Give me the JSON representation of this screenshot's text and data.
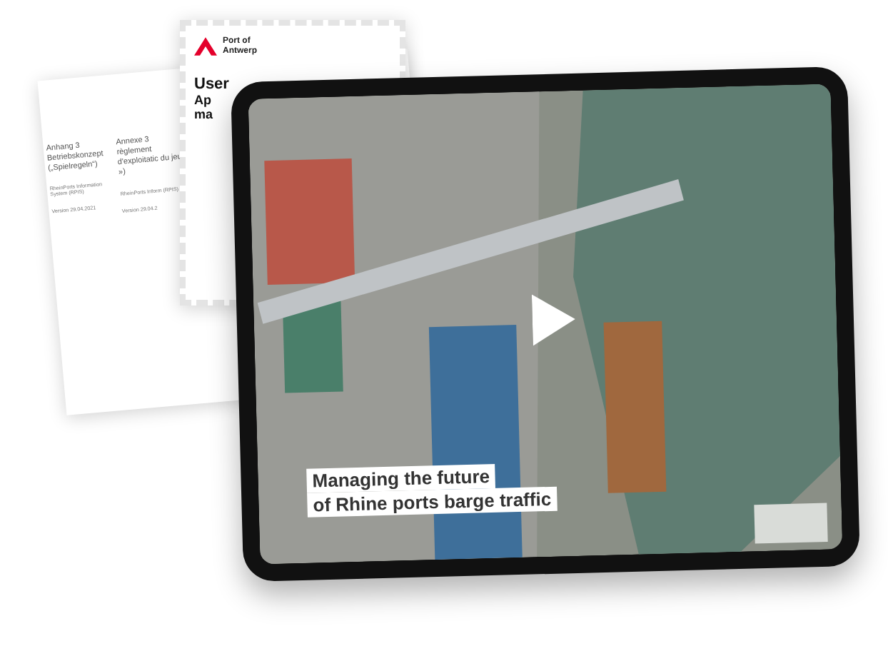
{
  "documents": [
    {
      "kind": "annex",
      "columns": [
        {
          "heading": "Anhang 3 Betriebskonzept („Spielregeln“)",
          "note": "RheinPorts Information System (RPIS)",
          "version": "Version 29.04.2021"
        },
        {
          "heading": "Annexe 3 règlement d'exploitatic du jeu »)",
          "note": "RheinPorts Inform (RPIS)",
          "version": "Version 29.04.2"
        }
      ]
    },
    {
      "kind": "manual",
      "logo": [
        "Port of",
        "Antwerp"
      ],
      "title": "User",
      "subtitle": [
        "Ap",
        "ma"
      ]
    }
  ],
  "tablet": {
    "video": {
      "caption": [
        "Managing the future",
        "of Rhine ports barge traffic"
      ]
    }
  }
}
